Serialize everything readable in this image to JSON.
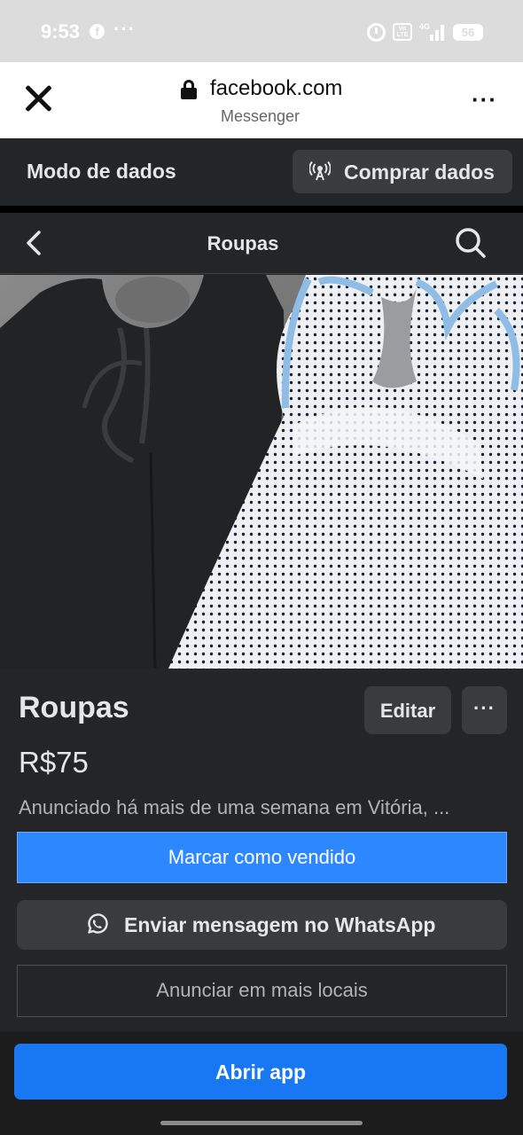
{
  "status_bar": {
    "time": "9:53",
    "app_badge": "f",
    "more": "···",
    "volte": "Vo LTE",
    "network": "4G",
    "battery": "56"
  },
  "browser": {
    "url": "facebook.com",
    "subtitle": "Messenger",
    "more": "···"
  },
  "data_banner": {
    "mode_label": "Modo de dados",
    "buy_label": "Comprar dados"
  },
  "nav": {
    "title": "Roupas"
  },
  "listing": {
    "title": "Roupas",
    "price": "R$75",
    "listed_text": "Anunciado há mais de uma semana em Vitória, ...",
    "edit_label": "Editar",
    "more_label": "···",
    "image": "two sleeveless jumpsuits: black (left) and white polka-dot with blue trim (right)"
  },
  "actions": {
    "mark_sold": "Marcar como vendido",
    "whatsapp": "Enviar mensagem no WhatsApp",
    "more_places": "Anunciar em mais locais",
    "open_app": "Abrir app"
  },
  "colors": {
    "background": "#242526",
    "primary_blue": "#1877f2",
    "sold_blue": "#2d88ff",
    "secondary_button": "#3a3b3c",
    "text_primary": "#e4e6eb",
    "text_secondary": "#b0b3b8"
  },
  "icons": [
    "close-icon",
    "lock-icon",
    "more-icon",
    "antenna-icon",
    "back-icon",
    "search-icon",
    "whatsapp-icon"
  ]
}
